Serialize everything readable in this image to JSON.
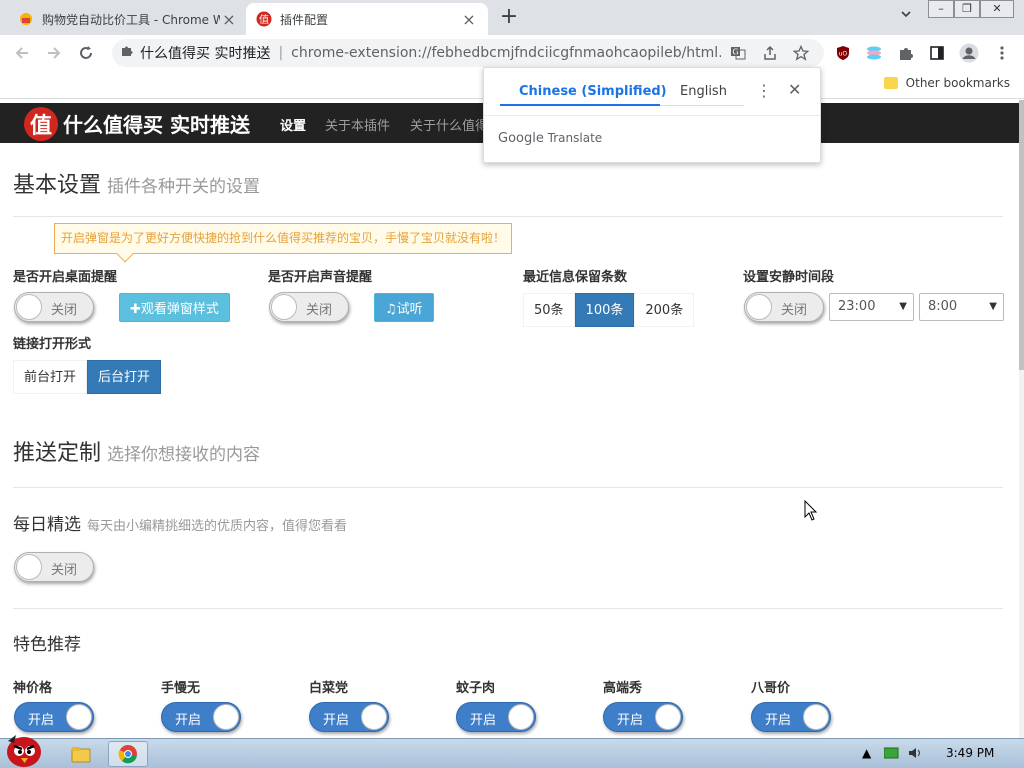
{
  "browser": {
    "tabs": [
      {
        "title": "购物党自动比价工具 - Chrome W",
        "active": false
      },
      {
        "title": "插件配置",
        "active": true
      }
    ],
    "omnibox": {
      "site": "什么值得买 实时推送",
      "separator": "|",
      "url": "chrome-extension://febhedbcmjfndciicgfnmaohcaopileb/html..."
    },
    "bookmarks": {
      "other": "Other bookmarks"
    }
  },
  "translate_popup": {
    "lang_selected": "Chinese (Simplified)",
    "lang_other": "English",
    "brand": "Google",
    "brand_suffix": "Translate"
  },
  "site": {
    "logo_char": "值",
    "brand": "什么值得买 实时推送",
    "nav": [
      "设置",
      "关于本插件",
      "关于什么值得"
    ]
  },
  "basic": {
    "title": "基本设置",
    "subtitle": "插件各种开关的设置",
    "tip": "开启弹窗是为了更好方便快捷的抢到什么值得买推荐的宝贝，手慢了宝贝就没有啦！",
    "desktop_label": "是否开启桌面提醒",
    "desktop_toggle": "关闭",
    "preview_button": "✚观看弹窗样式",
    "sound_label": "是否开启声音提醒",
    "sound_toggle": "关闭",
    "listen_button": "♫试听",
    "keep_label": "最近信息保留条数",
    "keep_options": [
      "50条",
      "100条",
      "200条"
    ],
    "keep_selected": "100条",
    "quiet_label": "设置安静时间段",
    "quiet_toggle": "关闭",
    "quiet_start": "23:00",
    "quiet_end": "8:00",
    "link_label": "链接打开形式",
    "link_options": [
      "前台打开",
      "后台打开"
    ],
    "link_selected": "后台打开"
  },
  "push": {
    "title": "推送定制",
    "subtitle": "选择你想接收的内容",
    "daily_title": "每日精选",
    "daily_subtitle": "每天由小编精挑细选的优质内容，值得您看看",
    "daily_toggle": "关闭",
    "featured_title": "特色推荐",
    "featured": [
      {
        "label": "神价格",
        "toggle": "开启"
      },
      {
        "label": "手慢无",
        "toggle": "开启"
      },
      {
        "label": "白菜党",
        "toggle": "开启"
      },
      {
        "label": "蚊子肉",
        "toggle": "开启"
      },
      {
        "label": "高端秀",
        "toggle": "开启"
      },
      {
        "label": "八哥价",
        "toggle": "开启"
      }
    ]
  },
  "taskbar": {
    "clock": "3:49 PM"
  },
  "colors": {
    "accent": "#337ab7",
    "toggle_on": "#3f7fca",
    "logo": "#d0271f",
    "nav_bg": "#222222"
  }
}
